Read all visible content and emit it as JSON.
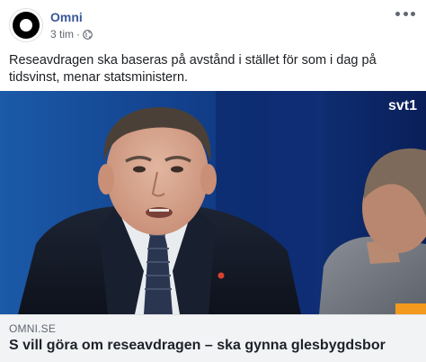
{
  "header": {
    "page_name": "Omni",
    "timestamp": "3 tim",
    "separator": "·",
    "privacy_icon": "globe-icon",
    "more_icon": "more-options-icon"
  },
  "post": {
    "text": "Reseavdragen ska baseras på avstånd i stället för som i dag på tidsvinst, menar statsministern."
  },
  "media": {
    "channel_logo": "svt1"
  },
  "link_preview": {
    "domain": "OMNI.SE",
    "title": "S vill göra om reseavdragen – ska gynna glesbygdsbor"
  },
  "colors": {
    "page_name": "#385898",
    "meta_text": "#616770",
    "caption_bg": "#f2f3f5",
    "studio_blue": "#0b2a6b"
  }
}
